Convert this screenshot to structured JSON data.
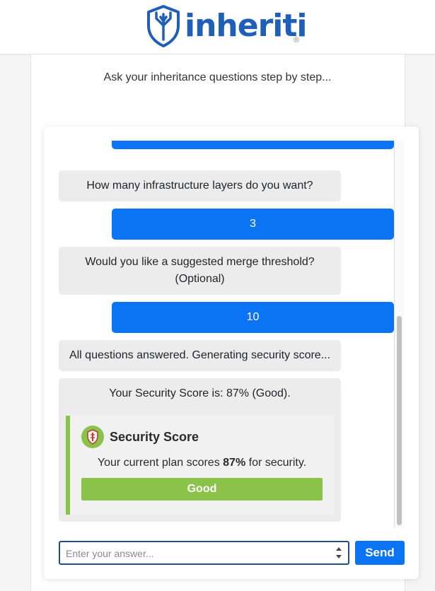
{
  "brand": {
    "name": "inheriti",
    "registered_mark": "®",
    "color": "#1f5fb9"
  },
  "subtitle": "Ask your inheritance questions step by step...",
  "colors": {
    "user_bubble": "#0b74f4",
    "bot_bubble": "#ececec",
    "good": "#8bc34a"
  },
  "messages": [
    {
      "role": "user",
      "text": ""
    },
    {
      "role": "bot",
      "text": "How many infrastructure layers do you want?"
    },
    {
      "role": "user",
      "text": "3"
    },
    {
      "role": "bot",
      "text": "Would you like a suggested merge threshold? (Optional)"
    },
    {
      "role": "user",
      "text": "10"
    },
    {
      "role": "bot",
      "text": "All questions answered. Generating security score..."
    },
    {
      "role": "bot",
      "text": "Your Security Score is: 87% (Good)."
    }
  ],
  "score_card": {
    "icon": "shield-icon",
    "title": "Security Score",
    "text_prefix": "Your current plan scores ",
    "score": "87%",
    "text_suffix": " for security.",
    "rating": "Good",
    "level": 0.87
  },
  "input": {
    "placeholder": "Enter your answer...",
    "value": ""
  },
  "send_label": "Send"
}
